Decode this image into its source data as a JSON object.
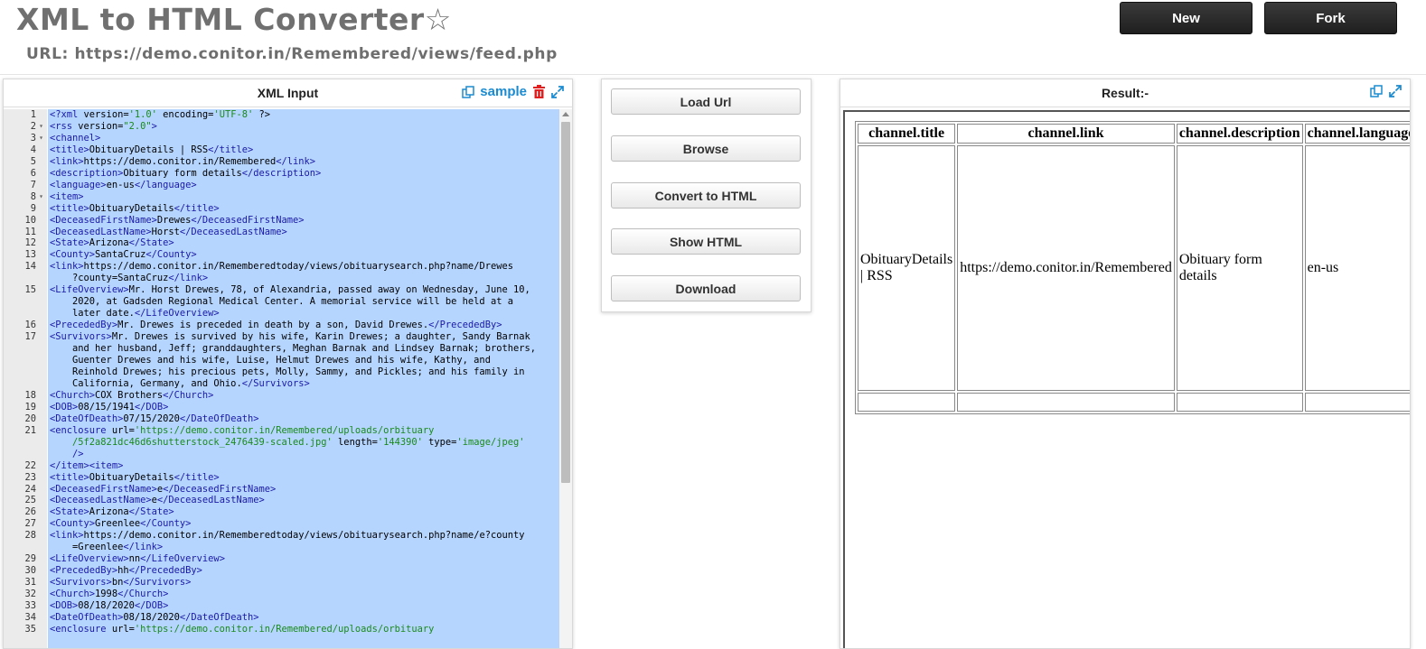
{
  "header": {
    "title": "XML to HTML Converter",
    "star": "☆",
    "url_label": "URL: https://demo.conitor.in/Remembered/views/feed.php",
    "new_label": "New",
    "fork_label": "Fork"
  },
  "left_panel": {
    "title": "XML Input",
    "sample_label": "sample",
    "lines": [
      {
        "n": "1",
        "f": "",
        "h": "<span class='t'>&lt;?xml</span> version=<span class='s'>'1.0'</span> encoding=<span class='s'>'UTF-8'</span> ?&gt;"
      },
      {
        "n": "2",
        "f": "▾",
        "h": "<span class='t'>&lt;rss</span> version=<span class='s'>\"2.0\"</span><span class='t'>&gt;</span>"
      },
      {
        "n": "3",
        "f": "▾",
        "h": "<span class='t'>&lt;channel&gt;</span>"
      },
      {
        "n": "4",
        "f": "",
        "h": "<span class='t'>&lt;title&gt;</span>ObituaryDetails | RSS<span class='t'>&lt;/title&gt;</span>"
      },
      {
        "n": "5",
        "f": "",
        "h": "<span class='t'>&lt;link&gt;</span>https://demo.conitor.in/Remembered<span class='t'>&lt;/link&gt;</span>"
      },
      {
        "n": "6",
        "f": "",
        "h": "<span class='t'>&lt;description&gt;</span>Obituary form details<span class='t'>&lt;/description&gt;</span>"
      },
      {
        "n": "7",
        "f": "",
        "h": "<span class='t'>&lt;language&gt;</span>en-us<span class='t'>&lt;/language&gt;</span>"
      },
      {
        "n": "8",
        "f": "▾",
        "h": "<span class='t'>&lt;item&gt;</span>"
      },
      {
        "n": "9",
        "f": "",
        "h": "<span class='t'>&lt;title&gt;</span>ObituaryDetails<span class='t'>&lt;/title&gt;</span>"
      },
      {
        "n": "10",
        "f": "",
        "h": "<span class='t'>&lt;DeceasedFirstName&gt;</span>Drewes<span class='t'>&lt;/DeceasedFirstName&gt;</span>"
      },
      {
        "n": "11",
        "f": "",
        "h": "<span class='t'>&lt;DeceasedLastName&gt;</span>Horst<span class='t'>&lt;/DeceasedLastName&gt;</span>"
      },
      {
        "n": "12",
        "f": "",
        "h": "<span class='t'>&lt;State&gt;</span>Arizona<span class='t'>&lt;/State&gt;</span>"
      },
      {
        "n": "13",
        "f": "",
        "h": "<span class='t'>&lt;County&gt;</span>SantaCruz<span class='t'>&lt;/County&gt;</span>"
      },
      {
        "n": "14",
        "f": "",
        "h": "<span class='t'>&lt;link&gt;</span>https://demo.conitor.in/Rememberedtoday/views/obituarysearch.php?name/Drewes"
      },
      {
        "n": "",
        "f": "",
        "h": "    ?county=SantaCruz<span class='t'>&lt;/link&gt;</span>"
      },
      {
        "n": "15",
        "f": "",
        "h": "<span class='t'>&lt;LifeOverview&gt;</span>Mr. Horst Drewes, 78, of Alexandria, passed away on Wednesday, June 10,"
      },
      {
        "n": "",
        "f": "",
        "h": "    2020, at Gadsden Regional Medical Center. A memorial service will be held at a"
      },
      {
        "n": "",
        "f": "",
        "h": "    later date.<span class='t'>&lt;/LifeOverview&gt;</span>"
      },
      {
        "n": "16",
        "f": "",
        "h": "<span class='t'>&lt;PrecededBy&gt;</span>Mr. Drewes is preceded in death by a son, David Drewes.<span class='t'>&lt;/PrecededBy&gt;</span>"
      },
      {
        "n": "17",
        "f": "",
        "h": "<span class='t'>&lt;Survivors&gt;</span>Mr. Drewes is survived by his wife, Karin Drewes; a daughter, Sandy Barnak"
      },
      {
        "n": "",
        "f": "",
        "h": "    and her husband, Jeff; granddaughters, Meghan Barnak and Lindsey Barnak; brothers,"
      },
      {
        "n": "",
        "f": "",
        "h": "    Guenter Drewes and his wife, Luise, Helmut Drewes and his wife, Kathy, and"
      },
      {
        "n": "",
        "f": "",
        "h": "    Reinhold Drewes; his precious pets, Molly, Sammy, and Pickles; and his family in"
      },
      {
        "n": "",
        "f": "",
        "h": "    California, Germany, and Ohio.<span class='t'>&lt;/Survivors&gt;</span>"
      },
      {
        "n": "18",
        "f": "",
        "h": "<span class='t'>&lt;Church&gt;</span>COX Brothers<span class='t'>&lt;/Church&gt;</span>"
      },
      {
        "n": "19",
        "f": "",
        "h": "<span class='t'>&lt;DOB&gt;</span>08/15/1941<span class='t'>&lt;/DOB&gt;</span>"
      },
      {
        "n": "20",
        "f": "",
        "h": "<span class='t'>&lt;DateOfDeath&gt;</span>07/15/2020<span class='t'>&lt;/DateOfDeath&gt;</span>"
      },
      {
        "n": "21",
        "f": "",
        "h": "<span class='t'>&lt;enclosure</span> url=<span class='s'>'https://demo.conitor.in/Remembered/uploads/orbituary</span>"
      },
      {
        "n": "",
        "f": "",
        "h": "<span class='s'>    /5f2a821dc46d6shutterstock_2476439-scaled.jpg'</span> length=<span class='s'>'144390'</span> type=<span class='s'>'image/jpeg'</span>"
      },
      {
        "n": "",
        "f": "",
        "h": "    <span class='t'>/&gt;</span>"
      },
      {
        "n": "22",
        "f": "",
        "h": "<span class='t'>&lt;/item&gt;&lt;item&gt;</span>"
      },
      {
        "n": "23",
        "f": "",
        "h": "<span class='t'>&lt;title&gt;</span>ObituaryDetails<span class='t'>&lt;/title&gt;</span>"
      },
      {
        "n": "24",
        "f": "",
        "h": "<span class='t'>&lt;DeceasedFirstName&gt;</span>e<span class='t'>&lt;/DeceasedFirstName&gt;</span>"
      },
      {
        "n": "25",
        "f": "",
        "h": "<span class='t'>&lt;DeceasedLastName&gt;</span>e<span class='t'>&lt;/DeceasedLastName&gt;</span>"
      },
      {
        "n": "26",
        "f": "",
        "h": "<span class='t'>&lt;State&gt;</span>Arizona<span class='t'>&lt;/State&gt;</span>"
      },
      {
        "n": "27",
        "f": "",
        "h": "<span class='t'>&lt;County&gt;</span>Greenlee<span class='t'>&lt;/County&gt;</span>"
      },
      {
        "n": "28",
        "f": "",
        "h": "<span class='t'>&lt;link&gt;</span>https://demo.conitor.in/Rememberedtoday/views/obituarysearch.php?name/e?county"
      },
      {
        "n": "",
        "f": "",
        "h": "    =Greenlee<span class='t'>&lt;/link&gt;</span>"
      },
      {
        "n": "29",
        "f": "",
        "h": "<span class='t'>&lt;LifeOverview&gt;</span>nn<span class='t'>&lt;/LifeOverview&gt;</span>"
      },
      {
        "n": "30",
        "f": "",
        "h": "<span class='t'>&lt;PrecededBy&gt;</span>hh<span class='t'>&lt;/PrecededBy&gt;</span>"
      },
      {
        "n": "31",
        "f": "",
        "h": "<span class='t'>&lt;Survivors&gt;</span>bn<span class='t'>&lt;/Survivors&gt;</span>"
      },
      {
        "n": "32",
        "f": "",
        "h": "<span class='t'>&lt;Church&gt;</span>1998<span class='t'>&lt;/Church&gt;</span>"
      },
      {
        "n": "33",
        "f": "",
        "h": "<span class='t'>&lt;DOB&gt;</span>08/18/2020<span class='t'>&lt;/DOB&gt;</span>"
      },
      {
        "n": "34",
        "f": "",
        "h": "<span class='t'>&lt;DateOfDeath&gt;</span>08/18/2020<span class='t'>&lt;/DateOfDeath&gt;</span>"
      },
      {
        "n": "35",
        "f": "",
        "h": "<span class='t'>&lt;enclosure</span> url=<span class='s'>'https://demo.conitor.in/Remembered/uploads/orbituary</span>"
      }
    ]
  },
  "middle_panel": {
    "buttons": [
      "Load Url",
      "Browse",
      "Convert to HTML",
      "Show HTML",
      "Download"
    ]
  },
  "right_panel": {
    "title": "Result:-",
    "table": {
      "headers": [
        "channel.title",
        "channel.link",
        "channel.description",
        "channel.language"
      ],
      "row": [
        "ObituaryDetails | RSS",
        "https://demo.conitor.in/Remembered",
        "Obituary form details",
        "en-us"
      ]
    }
  },
  "colors": {
    "accent": "#1a8bd1",
    "selection": "#b5d5ff",
    "delete": "#e02020"
  }
}
